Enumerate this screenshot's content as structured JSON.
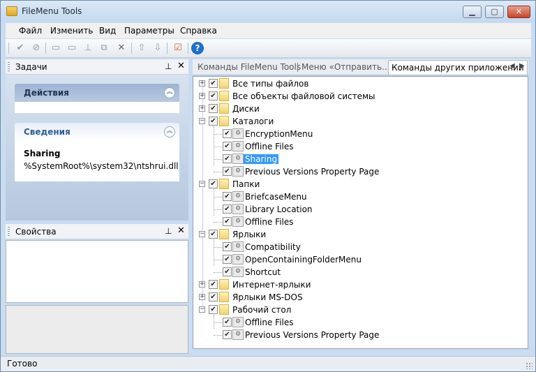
{
  "window": {
    "title": "FileMenu Tools"
  },
  "menu": [
    "Файл",
    "Изменить",
    "Вид",
    "Параметры",
    "Справка"
  ],
  "toolbar_icons": [
    {
      "name": "check-circle-icon",
      "glyph": "✔"
    },
    {
      "name": "cancel-circle-icon",
      "glyph": "⊘"
    },
    {
      "name": "add-item-icon",
      "glyph": "▭"
    },
    {
      "name": "add-subitem-icon",
      "glyph": "▭"
    },
    {
      "name": "add-separator-icon",
      "glyph": "⊥"
    },
    {
      "name": "copy-icon",
      "glyph": "⧉"
    },
    {
      "name": "delete-icon",
      "glyph": "✕"
    },
    {
      "name": "move-up-icon",
      "glyph": "⇧"
    },
    {
      "name": "move-down-icon",
      "glyph": "⇩"
    },
    {
      "name": "checklist-icon",
      "glyph": "☑"
    },
    {
      "name": "help-icon",
      "glyph": "?"
    }
  ],
  "tasks_pane": {
    "title": "Задачи",
    "actions_group": "Действия",
    "info_group": "Сведения",
    "info_title": "Sharing",
    "info_path": "%SystemRoot%\\system32\\ntshrui.dll"
  },
  "props_pane": {
    "title": "Свойства"
  },
  "tabs": [
    "Команды  FileMenu Tools",
    "Меню «Отправить...»",
    "Команды других приложений"
  ],
  "tree": [
    {
      "label": "Все типы файлов",
      "type": "folder",
      "expanded": false,
      "level": 0
    },
    {
      "label": "Все объекты файловой системы",
      "type": "folder",
      "expanded": false,
      "level": 0
    },
    {
      "label": "Диски",
      "type": "folder",
      "expanded": false,
      "level": 0
    },
    {
      "label": "Каталоги",
      "type": "folder",
      "expanded": true,
      "level": 0
    },
    {
      "label": "EncryptionMenu",
      "type": "command",
      "level": 1
    },
    {
      "label": "Offline Files",
      "type": "command",
      "level": 1
    },
    {
      "label": "Sharing",
      "type": "command",
      "level": 1,
      "selected": true
    },
    {
      "label": "Previous Versions Property Page",
      "type": "command",
      "level": 1
    },
    {
      "label": "Папки",
      "type": "folder",
      "expanded": true,
      "level": 0
    },
    {
      "label": "BriefcaseMenu",
      "type": "command",
      "level": 1
    },
    {
      "label": "Library Location",
      "type": "command",
      "level": 1
    },
    {
      "label": "Offline Files",
      "type": "command",
      "level": 1
    },
    {
      "label": "Ярлыки",
      "type": "folder",
      "expanded": true,
      "level": 0
    },
    {
      "label": "Compatibility",
      "type": "command",
      "level": 1
    },
    {
      "label": "OpenContainingFolderMenu",
      "type": "command",
      "level": 1
    },
    {
      "label": "Shortcut",
      "type": "command",
      "level": 1
    },
    {
      "label": "Интернет-ярлыки",
      "type": "folder",
      "expanded": false,
      "level": 0
    },
    {
      "label": "Ярлыки MS-DOS",
      "type": "folder",
      "expanded": false,
      "level": 0
    },
    {
      "label": "Рабочий стол",
      "type": "folder",
      "expanded": true,
      "level": 0
    },
    {
      "label": "Offline Files",
      "type": "command",
      "level": 1
    },
    {
      "label": "Previous Versions Property Page",
      "type": "command",
      "level": 1
    }
  ],
  "status": "Готово",
  "colors": {
    "selection": "#3399ff",
    "help": "#1e6fd0"
  }
}
